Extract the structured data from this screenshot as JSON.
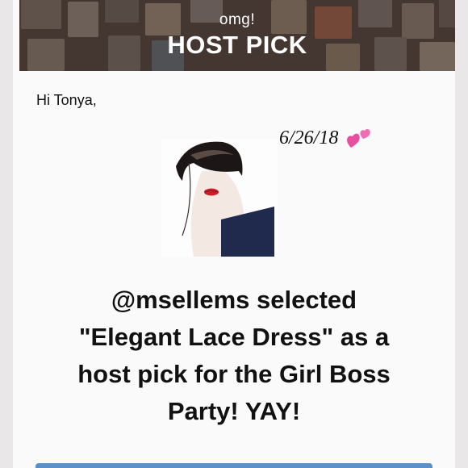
{
  "banner": {
    "subtitle": "omg!",
    "title": "HOST PICK"
  },
  "message": {
    "greeting": "Hi Tonya,",
    "date": "6/26/18",
    "headline_lines": [
      "@msellems selected",
      "\"Elegant Lace Dress\" as a",
      "host pick for the Girl Boss",
      "Party! YAY!"
    ]
  },
  "icons": {
    "date_decoration": "two-hearts-icon",
    "photo": "fashion-illustration-image"
  },
  "colors": {
    "banner": "#5b4a43",
    "card": "#fbfafa",
    "heart": "#e84fa0",
    "button": "#5b90c9"
  }
}
